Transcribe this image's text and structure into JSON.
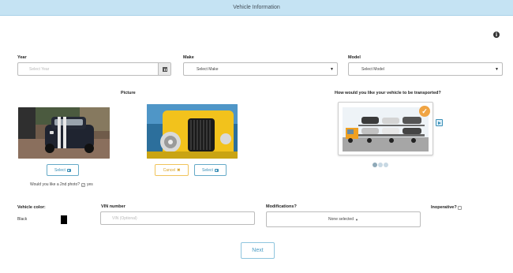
{
  "header": {
    "title": "Vehicle Information"
  },
  "year": {
    "label": "Year",
    "placeholder": "Select Year"
  },
  "make": {
    "label": "Make",
    "value": "Select Make"
  },
  "model": {
    "label": "Model",
    "value": "Select Model"
  },
  "picture": {
    "label": "Picture",
    "select_label": "Select",
    "cancel_label": "Cancel",
    "second_photo_question": "Would you like a 2nd photo?",
    "second_photo_answer": "yes",
    "second_photo_checked": true
  },
  "transport": {
    "question": "How would you like your vehicle to be transported?",
    "slides": 3,
    "active_slide": 1
  },
  "vehicle_color": {
    "label": "Vehicle color:",
    "value": "Black",
    "swatch": "#000000"
  },
  "vin": {
    "label": "VIN number",
    "placeholder": "VIN (Optional)"
  },
  "modifications": {
    "label": "Modifications?",
    "value": "None selected"
  },
  "inoperative": {
    "label": "Inoperative?",
    "checked": false
  },
  "actions": {
    "next_label": "Next"
  },
  "colors": {
    "header_bg": "#c5e3f3",
    "accent": "#3a8fb7",
    "cancel": "#f0c45c",
    "selected_badge": "#f0a443"
  }
}
